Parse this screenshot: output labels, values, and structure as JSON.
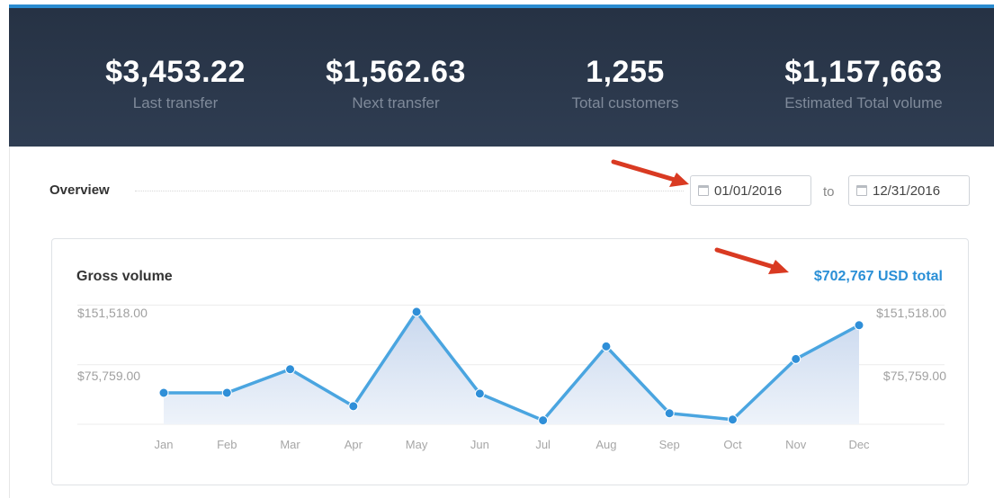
{
  "header": {
    "stats": [
      {
        "value": "$3,453.22",
        "label": "Last transfer"
      },
      {
        "value": "$1,562.63",
        "label": "Next transfer"
      },
      {
        "value": "1,255",
        "label": "Total customers"
      },
      {
        "value": "$1,157,663",
        "label": "Estimated Total volume"
      }
    ]
  },
  "overview": {
    "title": "Overview",
    "date_from": "01/01/2016",
    "to_label": "to",
    "date_to": "12/31/2016"
  },
  "gross_volume": {
    "title": "Gross volume",
    "total": "$702,767 USD total",
    "y_labels_left": [
      "$151,518.00",
      "$75,759.00"
    ],
    "y_labels_right": [
      "$151,518.00",
      "$75,759.00"
    ]
  },
  "chart_data": {
    "type": "area",
    "title": "Gross volume",
    "categories": [
      "Jan",
      "Feb",
      "Mar",
      "Apr",
      "May",
      "Jun",
      "Jul",
      "Aug",
      "Sep",
      "Oct",
      "Nov",
      "Dec"
    ],
    "values": [
      40000,
      40000,
      70000,
      23000,
      143000,
      39000,
      5000,
      99000,
      14000,
      6000,
      83000,
      126000
    ],
    "ylim": [
      0,
      160000
    ],
    "yticks": [
      75759,
      151518
    ],
    "grid": true,
    "colors": {
      "line": "#4aa5e0",
      "fill_top": "#c9d8ee",
      "fill_bottom": "#eef3fa"
    }
  },
  "colors": {
    "header_bg": "#2b384b",
    "accent": "#2a8fd6",
    "annotation_arrow": "#d93a22"
  }
}
